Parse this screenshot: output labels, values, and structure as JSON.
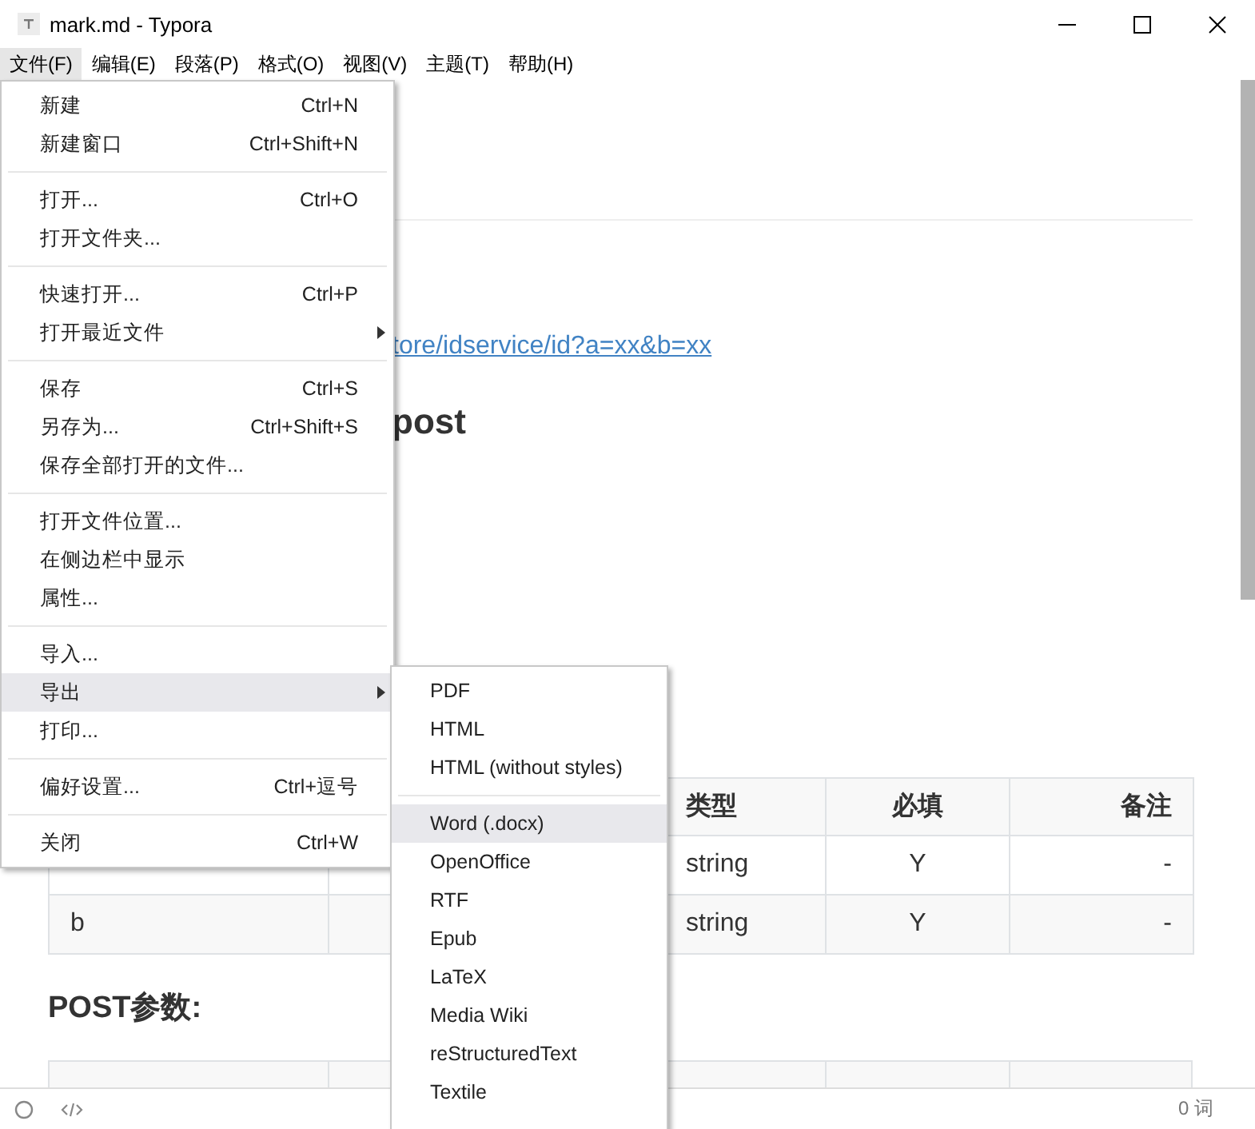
{
  "window": {
    "title": "mark.md - Typora"
  },
  "menu_bar": [
    {
      "label": "文件(F)",
      "selected": true
    },
    {
      "label": "编辑(E)",
      "selected": false
    },
    {
      "label": "段落(P)",
      "selected": false
    },
    {
      "label": "格式(O)",
      "selected": false
    },
    {
      "label": "视图(V)",
      "selected": false
    },
    {
      "label": "主题(T)",
      "selected": false
    },
    {
      "label": "帮助(H)",
      "selected": false
    }
  ],
  "file_menu": {
    "items": [
      {
        "kind": "item",
        "label": "新建",
        "shortcut": "Ctrl+N",
        "selected": false
      },
      {
        "kind": "item",
        "label": "新建窗口",
        "shortcut": "Ctrl+Shift+N",
        "selected": false
      },
      {
        "kind": "separator"
      },
      {
        "kind": "item",
        "label": "打开...",
        "shortcut": "Ctrl+O",
        "selected": false
      },
      {
        "kind": "item",
        "label": "打开文件夹...",
        "selected": false
      },
      {
        "kind": "separator"
      },
      {
        "kind": "item",
        "label": "快速打开...",
        "shortcut": "Ctrl+P",
        "selected": false
      },
      {
        "kind": "item",
        "label": "打开最近文件",
        "has_submenu": true,
        "selected": false
      },
      {
        "kind": "separator"
      },
      {
        "kind": "item",
        "label": "保存",
        "shortcut": "Ctrl+S",
        "selected": false
      },
      {
        "kind": "item",
        "label": "另存为...",
        "shortcut": "Ctrl+Shift+S",
        "selected": false
      },
      {
        "kind": "item",
        "label": "保存全部打开的文件...",
        "selected": false
      },
      {
        "kind": "separator"
      },
      {
        "kind": "item",
        "label": "打开文件位置...",
        "selected": false
      },
      {
        "kind": "item",
        "label": "在侧边栏中显示",
        "selected": false
      },
      {
        "kind": "item",
        "label": "属性...",
        "selected": false
      },
      {
        "kind": "separator"
      },
      {
        "kind": "item",
        "label": "导入...",
        "selected": false
      },
      {
        "kind": "item",
        "label": "导出",
        "has_submenu": true,
        "selected": true
      },
      {
        "kind": "item",
        "label": "打印...",
        "selected": false
      },
      {
        "kind": "separator"
      },
      {
        "kind": "item",
        "label": "偏好设置...",
        "shortcut": "Ctrl+逗号",
        "selected": false
      },
      {
        "kind": "separator"
      },
      {
        "kind": "item",
        "label": "关闭",
        "shortcut": "Ctrl+W",
        "selected": false
      }
    ]
  },
  "export_submenu": {
    "items": [
      {
        "kind": "item",
        "label": "PDF",
        "selected": false
      },
      {
        "kind": "item",
        "label": "HTML",
        "selected": false
      },
      {
        "kind": "item",
        "label": "HTML (without styles)",
        "selected": false
      },
      {
        "kind": "separator"
      },
      {
        "kind": "item",
        "label": "Word (.docx)",
        "selected": true
      },
      {
        "kind": "item",
        "label": "OpenOffice",
        "selected": false
      },
      {
        "kind": "item",
        "label": "RTF",
        "selected": false
      },
      {
        "kind": "item",
        "label": "Epub",
        "selected": false
      },
      {
        "kind": "item",
        "label": "LaTeX",
        "selected": false
      },
      {
        "kind": "item",
        "label": "Media Wiki",
        "selected": false
      },
      {
        "kind": "item",
        "label": "reStructuredText",
        "selected": false
      },
      {
        "kind": "item",
        "label": "Textile",
        "selected": false
      }
    ]
  },
  "document": {
    "link": "tore/idservice/id?a=xx&b=xx",
    "heading": "post",
    "table": {
      "header": {
        "column_3": "类型",
        "column_4": "必填",
        "column_5": "备注"
      },
      "rows": [
        {
          "column_3": "string",
          "column_4": "Y",
          "column_5": "-"
        },
        {
          "column_1": "b",
          "column_3": "string",
          "column_4": "Y",
          "column_5": "-"
        }
      ]
    },
    "section_heading": "POST参数:"
  },
  "status_bar": {
    "word_count": "0 词"
  }
}
